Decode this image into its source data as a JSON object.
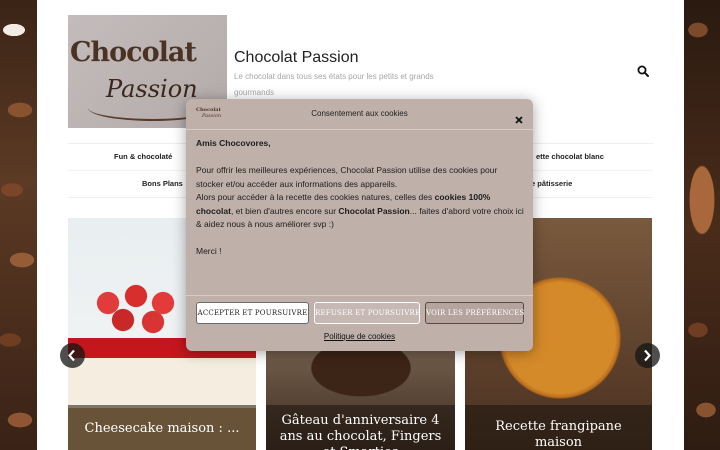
{
  "site": {
    "title": "Chocolat Passion",
    "tagline": "Le chocolat dans tous ses états pour les petits et grands gourmands",
    "logo_text_1": "Chocolat",
    "logo_text_2": "Passion"
  },
  "nav": {
    "row1_left": "Fun & chocolaté",
    "row1_right": "ette chocolat blanc",
    "row2_left": "Bons Plans",
    "row2_right": "e pâtisserie"
  },
  "slides": [
    {
      "caption": "Cheesecake maison : ..."
    },
    {
      "caption": "Gâteau d'anniversaire 4 ans au chocolat, Fingers et Smarties"
    },
    {
      "caption": "Recette frangipane maison"
    }
  ],
  "cookie_modal": {
    "title": "Consentement aux cookies",
    "greeting": "Amis Chocovores,",
    "line1": "Pour offrir les meilleures expériences, Chocolat Passion utilise des cookies pour stocker et/ou accéder aux informations des appareils.",
    "line2_a": "Alors pour accéder à la recette des cookies natures, celles des ",
    "line2_b": "cookies 100% chocolat",
    "line2_c": ", et bien d'autres encore sur ",
    "line2_d": "Chocolat Passion",
    "line2_e": "... faites d'abord votre choix ici & aidez nous à nous améliorer svp :)",
    "thanks": "Merci !",
    "accept_label": "ACCEPTER ET POURSUIVRE",
    "refuse_label": "REFUSER ET POURSUIVRE",
    "prefs_label": "VOIR LES PRÉFÉRENCES",
    "policy_label": "Politique de cookies",
    "logo_text_1": "Chocolat",
    "logo_text_2": "Passion"
  },
  "icons": {
    "search": "search-icon",
    "close": "close-icon",
    "prev": "chevron-left-icon",
    "next": "chevron-right-icon"
  },
  "colors": {
    "modal_bg": "#bfb0aa",
    "accent_dark": "#4a3324"
  }
}
